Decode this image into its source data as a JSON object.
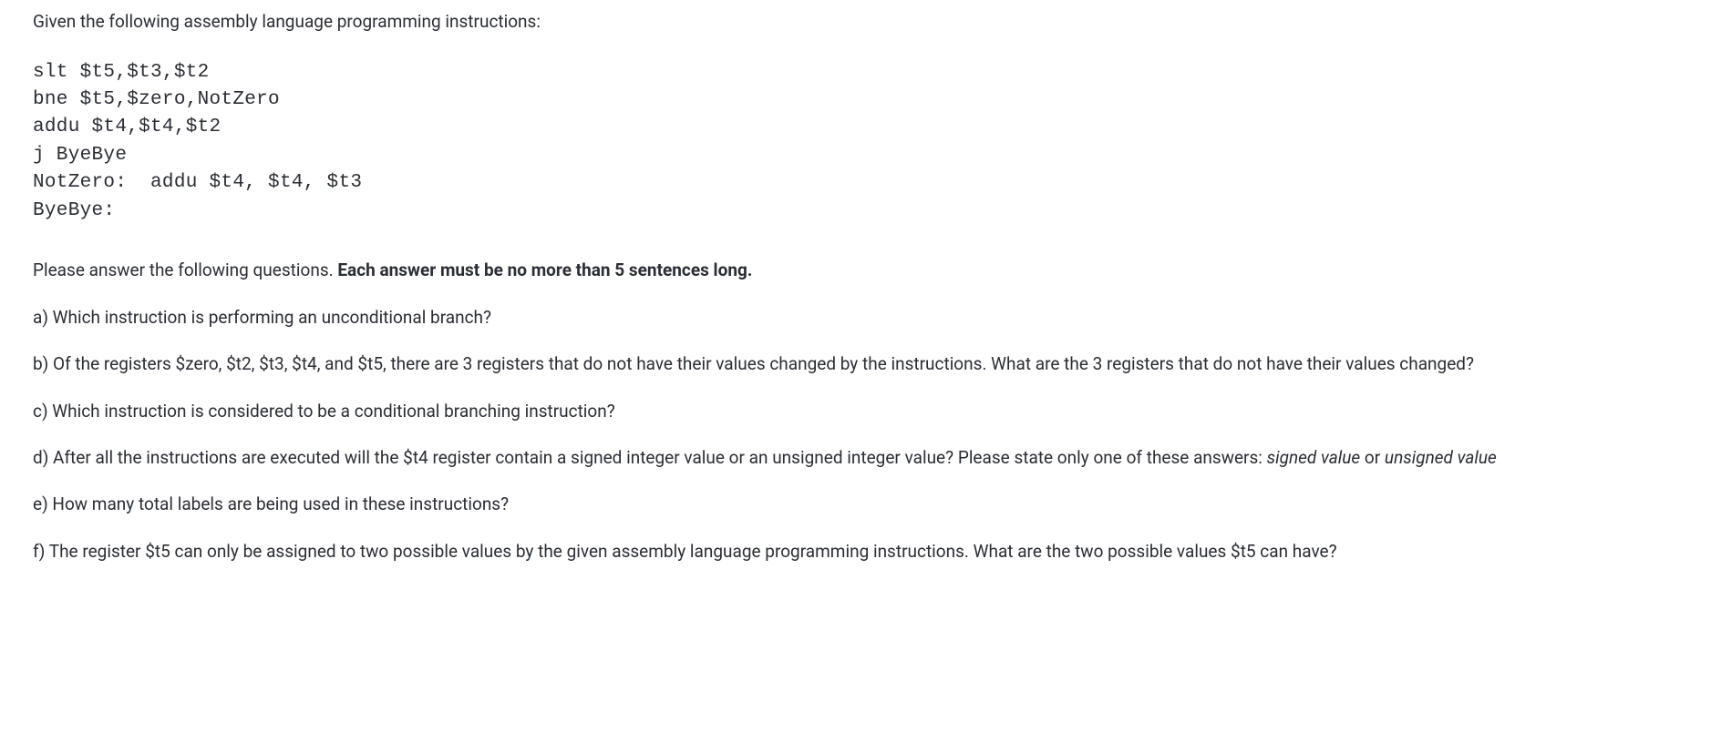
{
  "intro": "Given the following assembly language programming instructions:",
  "code": "slt $t5,$t3,$t2\nbne $t5,$zero,NotZero\naddu $t4,$t4,$t2\nj ByeBye\nNotZero:  addu $t4, $t4, $t3\nByeBye:",
  "instructions_prefix": "Please answer the following questions. ",
  "instructions_bold": "Each answer must be no more than 5 sentences long.",
  "questions": {
    "a": "a) Which instruction is performing an unconditional branch?",
    "b": "b) Of the registers $zero, $t2, $t3, $t4, and $t5, there are 3 registers that do not have their values changed by the instructions.  What are the 3 registers that do not have their values changed?",
    "c": "c) Which instruction is considered to be a conditional branching instruction?",
    "d_prefix": "d) After all the instructions are executed will the $t4 register contain a signed integer value or an unsigned integer value?  Please state only one of these answers:  ",
    "d_italic1": "signed value",
    "d_mid": " or ",
    "d_italic2": "unsigned value",
    "e": "e) How many total labels are being used in these instructions?",
    "f": "f)  The register $t5 can only be assigned to two possible values by the given assembly language programming instructions.  What are the two possible values $t5 can have?"
  }
}
